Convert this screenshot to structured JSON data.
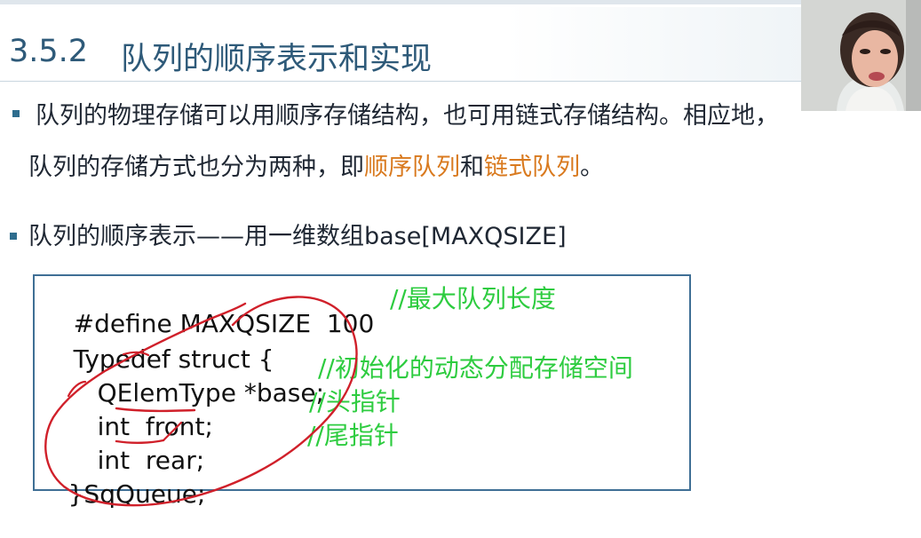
{
  "slide": {
    "section_number": "3.5.2",
    "section_title": "队列的顺序表示和实现"
  },
  "bullets": {
    "b1_line1": "队列的物理存储可以用顺序存储结构，也可用链式存储结构。相应地，",
    "b1_line2_pre": "队列的存储方式也分为两种，即",
    "b1_term1": "顺序队列",
    "b1_and": "和",
    "b1_term2": "链式队列",
    "b1_end": "。",
    "b2": "队列的顺序表示——用一维数组base[MAXQSIZE]"
  },
  "code": {
    "line1": "#define MAXQSIZE  100",
    "line1_comment": "//最大队列长度",
    "line2": "Typedef struct {",
    "line3": "QElemType *base;",
    "line3_comment": "//初始化的动态分配存储空间",
    "line4": "int  front;",
    "line4_comment": "//头指针",
    "line5": "int  rear;",
    "line5_comment": "//尾指针",
    "line6": "}SqQueue;"
  },
  "colors": {
    "accent": "#d97a1f",
    "comment": "#2ecc40",
    "title": "#2e5a79",
    "annotation": "#d0202a",
    "frame": "#3f6f95"
  },
  "icons": {
    "bullet": "square-bullet-icon",
    "presenter": "presenter-video-icon"
  }
}
